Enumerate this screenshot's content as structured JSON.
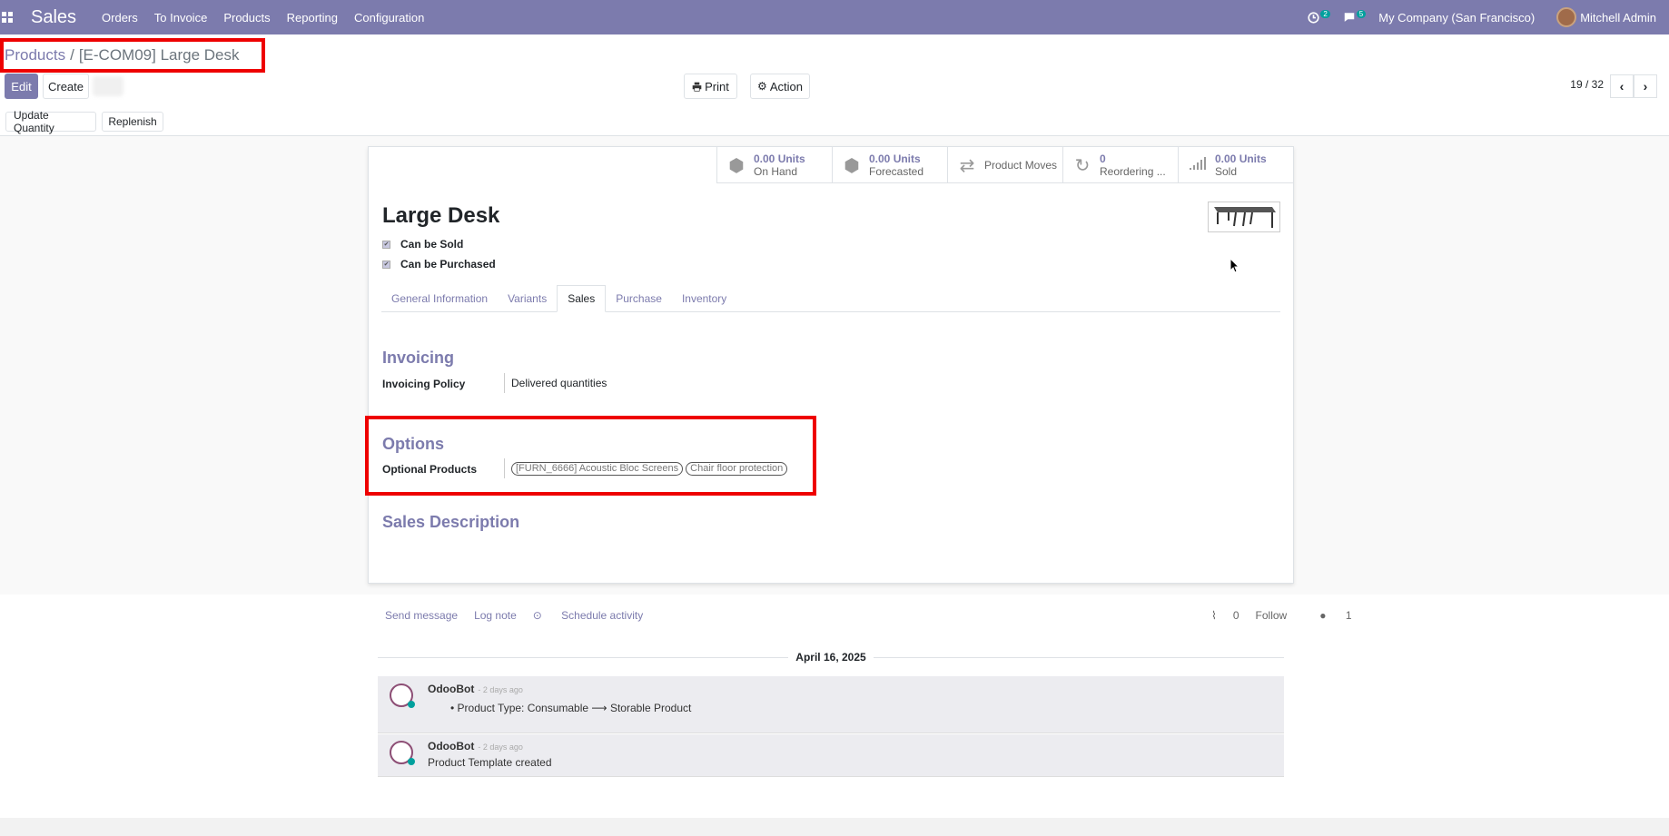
{
  "topbar": {
    "app_name": "Sales",
    "menu": [
      "Orders",
      "To Invoice",
      "Products",
      "Reporting",
      "Configuration"
    ],
    "activity_count": "2",
    "messages_count": "5",
    "company": "My Company (San Francisco)",
    "user": "Mitchell Admin"
  },
  "breadcrumb": {
    "parent": "Products",
    "separator": "/",
    "current": "[E-COM09] Large Desk"
  },
  "toolbar": {
    "edit_label": "Edit",
    "create_label": "Create",
    "print_label": "Print",
    "action_label": "Action",
    "pager": "19 / 32",
    "update_quantity_label": "Update Quantity",
    "replenish_label": "Replenish"
  },
  "smart_buttons": [
    {
      "value": "0.00 Units",
      "label": "On Hand",
      "icon": "cubes-icon"
    },
    {
      "value": "0.00 Units",
      "label": "Forecasted",
      "icon": "cubes-icon"
    },
    {
      "value": "",
      "label": "Product Moves",
      "icon": "exchange-icon"
    },
    {
      "value": "0",
      "label": "Reordering ...",
      "icon": "refresh-icon"
    },
    {
      "value": "0.00 Units",
      "label": "Sold",
      "icon": "signal-icon"
    }
  ],
  "product": {
    "name": "Large Desk",
    "can_be_sold_label": "Can be Sold",
    "can_be_purchased_label": "Can be Purchased"
  },
  "tabs": [
    "General Information",
    "Variants",
    "Sales",
    "Purchase",
    "Inventory"
  ],
  "sales_tab": {
    "invoicing_title": "Invoicing",
    "invoicing_policy_label": "Invoicing Policy",
    "invoicing_policy_value": "Delivered quantities",
    "options_title": "Options",
    "optional_products_label": "Optional Products",
    "optional_products": [
      "[FURN_6666] Acoustic Bloc Screens",
      "Chair floor protection"
    ],
    "sales_description_title": "Sales Description"
  },
  "chatter": {
    "send_message": "Send message",
    "log_note": "Log note",
    "schedule_activity": "Schedule activity",
    "attachments": "0",
    "follow": "Follow",
    "followers": "1",
    "date": "April 16, 2025",
    "messages": [
      {
        "author": "OdooBot",
        "time": "- 2 days ago",
        "body": "Product Type: Consumable ⟶ Storable Product"
      },
      {
        "author": "OdooBot",
        "time": "- 2 days ago",
        "body": "Product Template created"
      }
    ]
  },
  "colors": {
    "brand": "#7c7bad",
    "highlight": "#e00000"
  }
}
